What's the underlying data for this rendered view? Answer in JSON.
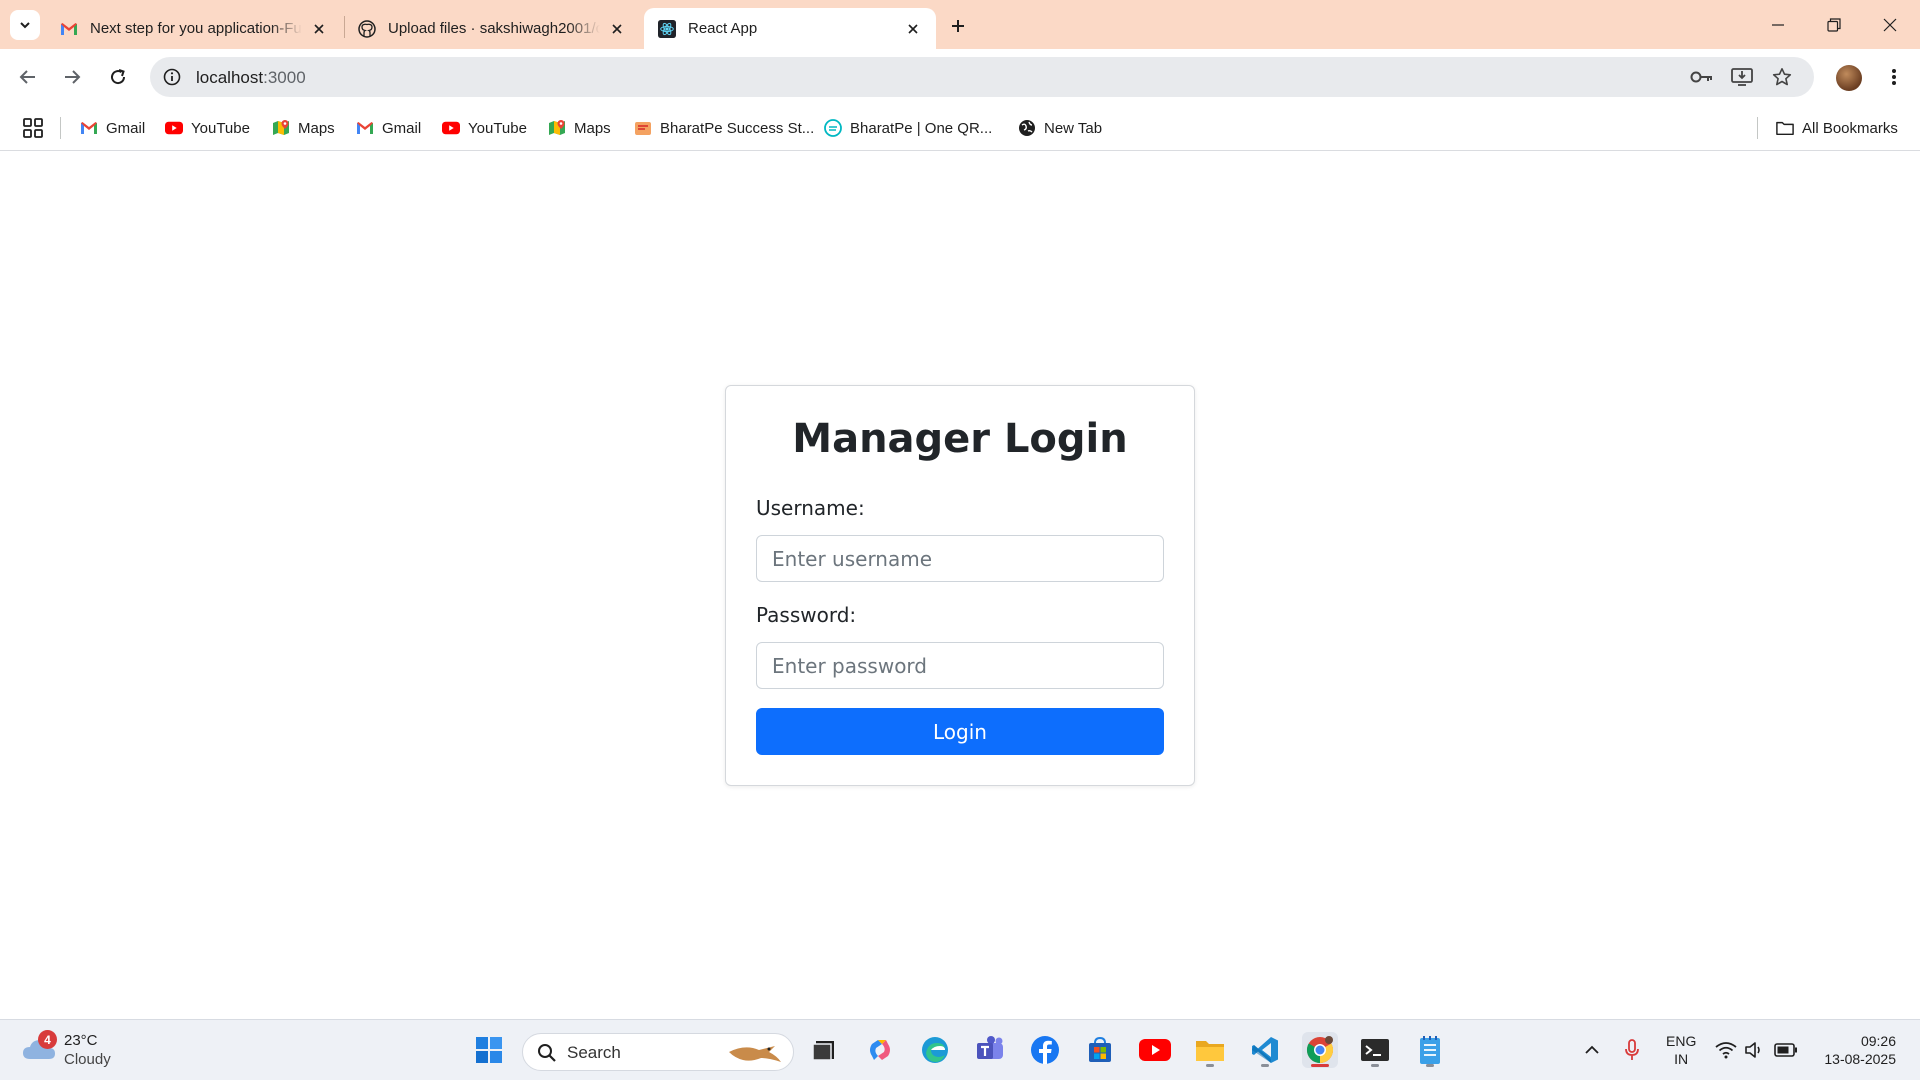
{
  "browser": {
    "tabs": [
      {
        "title": "Next step for you application-Fu",
        "icon": "gmail-icon",
        "active": false
      },
      {
        "title": "Upload files · sakshiwagh2001/c",
        "icon": "github-icon",
        "active": false
      },
      {
        "title": "React App",
        "icon": "react-icon",
        "active": true
      }
    ],
    "address": {
      "host": "localhost",
      "port": ":3000"
    },
    "bookmarks": [
      {
        "label": "Gmail",
        "icon": "gmail-icon"
      },
      {
        "label": "YouTube",
        "icon": "youtube-icon"
      },
      {
        "label": "Maps",
        "icon": "maps-icon"
      },
      {
        "label": "Gmail",
        "icon": "gmail-icon"
      },
      {
        "label": "YouTube",
        "icon": "youtube-icon"
      },
      {
        "label": "Maps",
        "icon": "maps-icon"
      },
      {
        "label": "BharatPe Success St...",
        "icon": "bharatpe-icon"
      },
      {
        "label": "BharatPe | One QR...",
        "icon": "bharatpe-qr-icon"
      },
      {
        "label": "New Tab",
        "icon": "globe-icon"
      }
    ],
    "all_bookmarks": "All Bookmarks"
  },
  "login": {
    "title": "Manager Login",
    "username_label": "Username:",
    "username_placeholder": "Enter username",
    "password_label": "Password:",
    "password_placeholder": "Enter password",
    "submit_label": "Login"
  },
  "colors": {
    "tabstrip": "#fbd9c6",
    "primary_button": "#0d6efd"
  },
  "taskbar": {
    "weather": {
      "temp": "23°C",
      "condition": "Cloudy",
      "badge": "4"
    },
    "search_label": "Search",
    "language": {
      "line1": "ENG",
      "line2": "IN"
    },
    "clock": {
      "time": "09:26",
      "date": "13-08-2025"
    }
  }
}
